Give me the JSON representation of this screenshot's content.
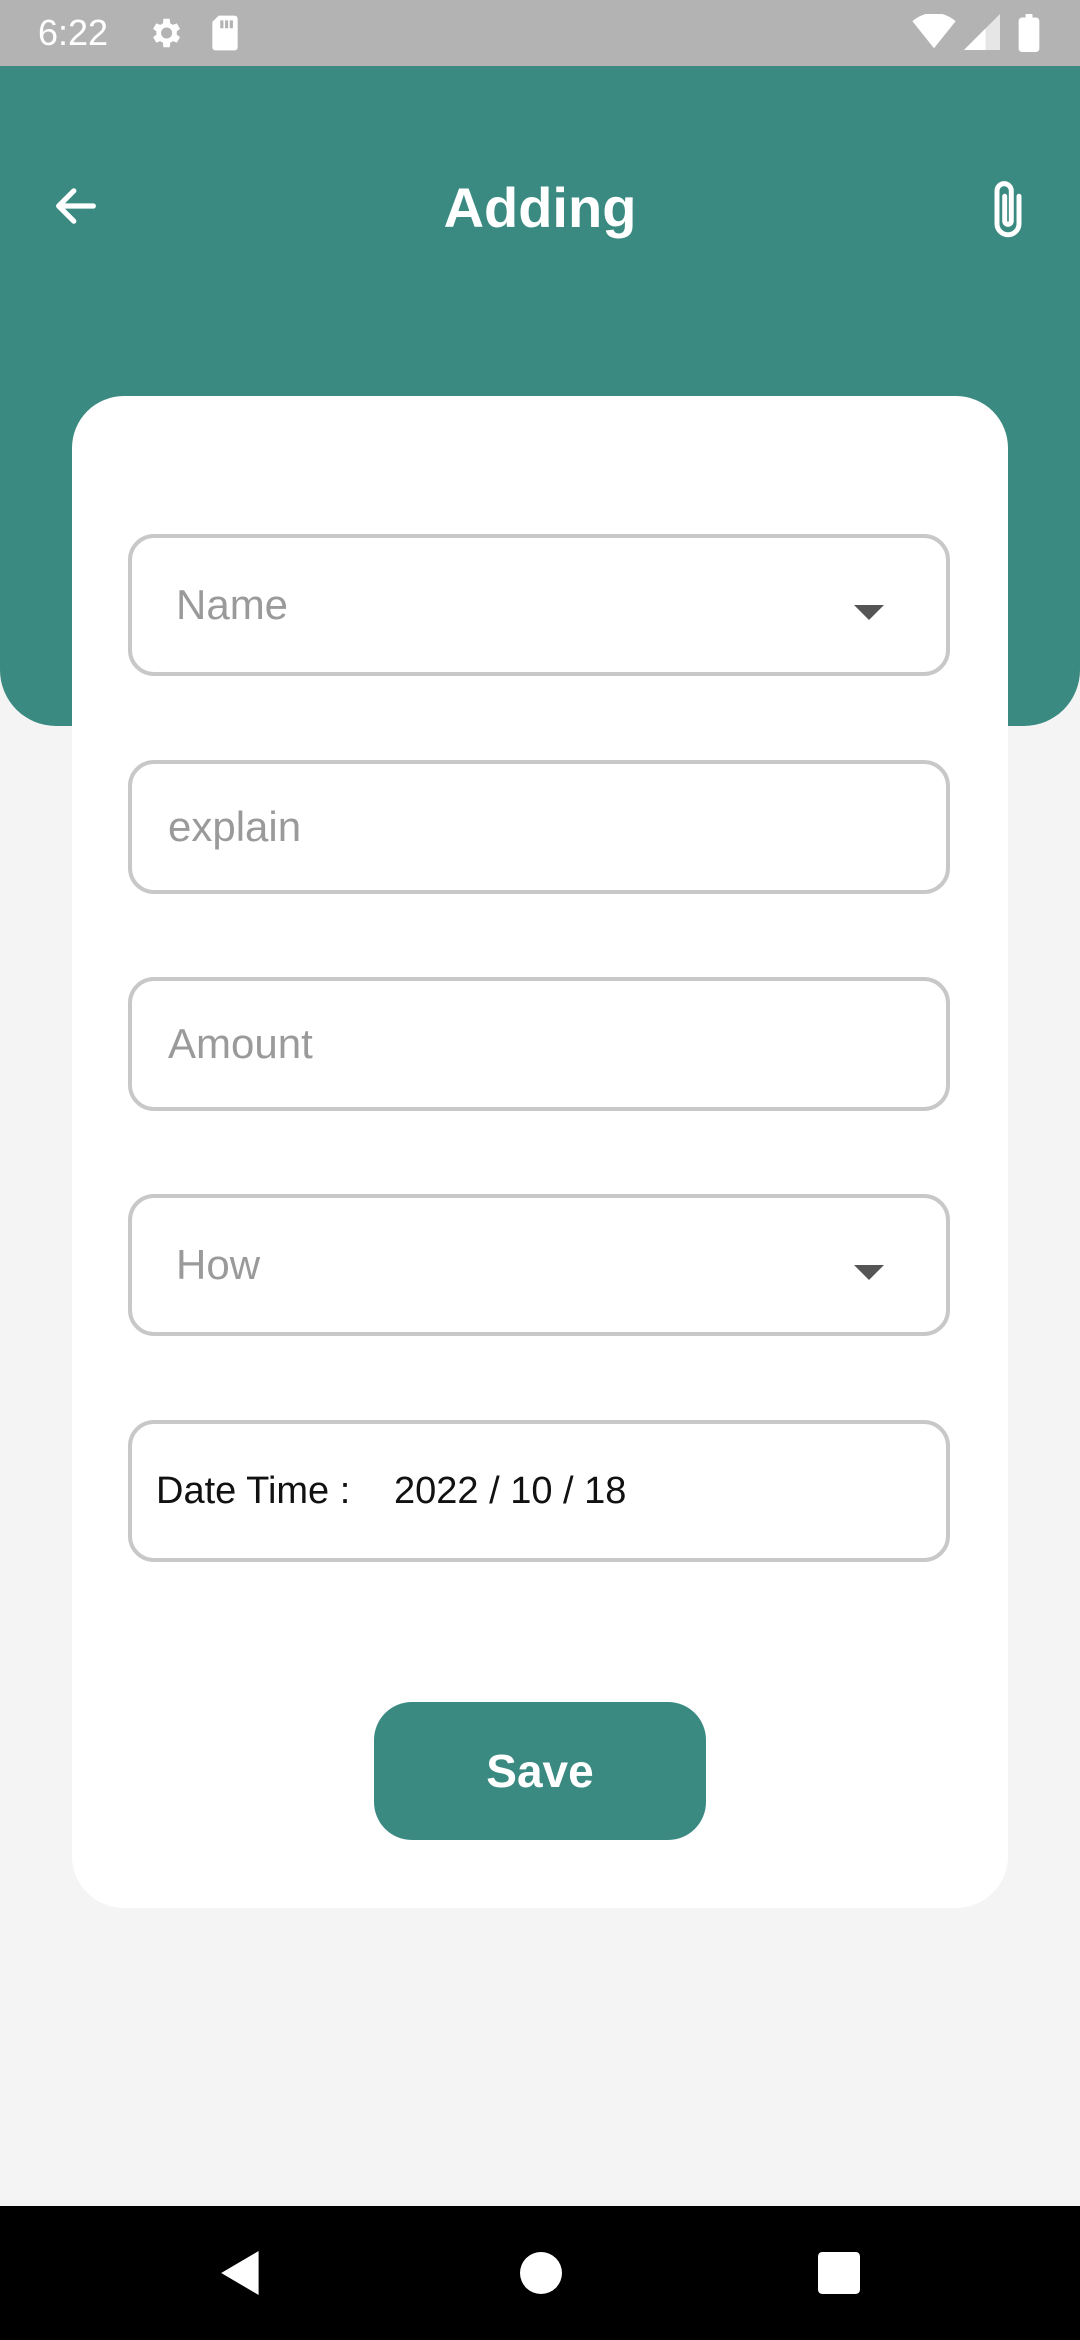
{
  "status_bar": {
    "time": "6:22",
    "icons": [
      "settings-icon",
      "sd-card-icon",
      "wifi-icon",
      "signal-icon",
      "battery-icon"
    ]
  },
  "header": {
    "title": "Adding",
    "back_icon": "arrow-left-icon",
    "attach_icon": "paperclip-icon",
    "color": "#3a8a82"
  },
  "form": {
    "name_dropdown": {
      "placeholder": "Name"
    },
    "explain_input": {
      "placeholder": "explain"
    },
    "amount_input": {
      "placeholder": "Amount"
    },
    "how_dropdown": {
      "placeholder": "How"
    },
    "date_time": {
      "label": "Date Time :",
      "value": "2022 / 10 / 18"
    },
    "save_label": "Save"
  },
  "nav_bar": {
    "buttons": [
      "back-triangle-icon",
      "home-circle-icon",
      "recents-square-icon"
    ]
  }
}
